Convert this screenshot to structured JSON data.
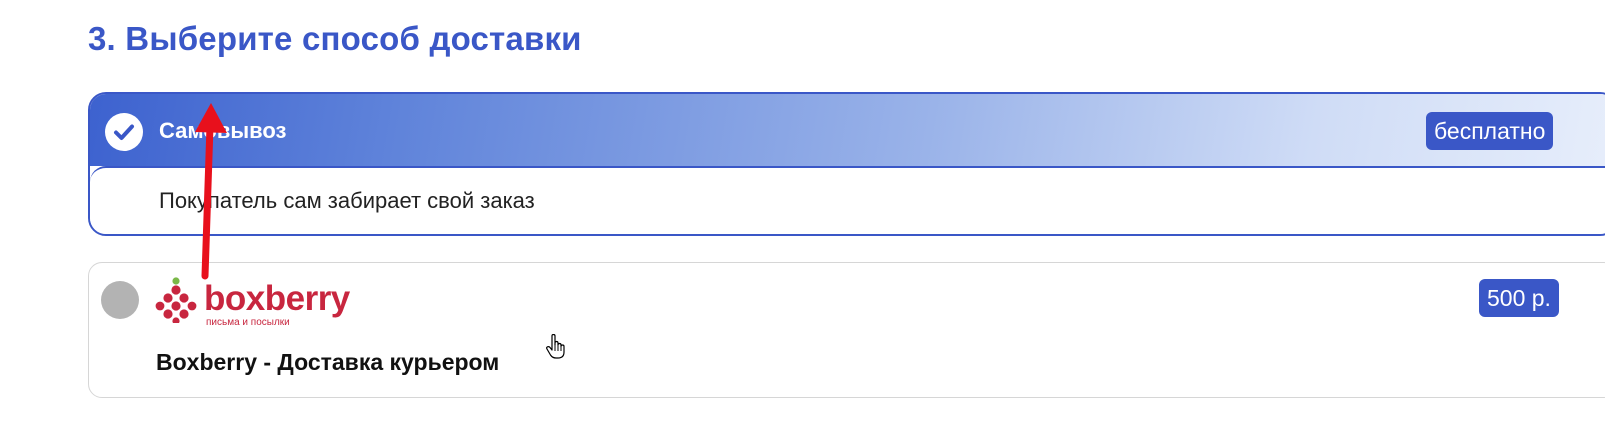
{
  "section": {
    "title": "3. Выберите способ доставки"
  },
  "options": [
    {
      "title": "Самовывоз",
      "price": "бесплатно",
      "description": "Покупатель сам забирает свой заказ",
      "selected": true
    },
    {
      "title": "Boxberry - Доставка курьером",
      "price": "500 р.",
      "selected": false,
      "logo": {
        "word": "boxberry",
        "tagline": "письма и посылки"
      }
    }
  ],
  "colors": {
    "accent": "#3a57c7",
    "brand_boxberry": "#c8263f",
    "radio_unselected": "#b3b3b3",
    "annotation_arrow": "#e8101c"
  },
  "icons": {
    "selected_option": "check-circle-icon",
    "unselected_option": "radio-unselected-icon",
    "annotation": "red-arrow-up-icon",
    "cursor": "hand-pointer-cursor-icon"
  }
}
